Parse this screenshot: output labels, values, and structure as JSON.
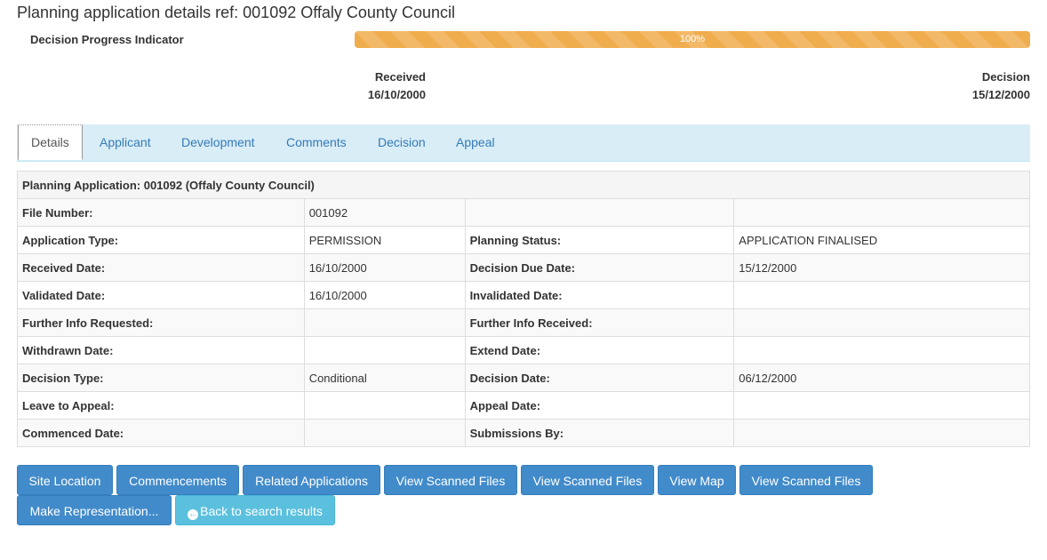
{
  "page": {
    "title": "Planning application details ref: 001092 Offaly County Council"
  },
  "progress": {
    "label": "Decision Progress Indicator",
    "percent": 100,
    "percent_text": "100%",
    "bar_color": "#f0ad4e",
    "received_label": "Received",
    "received_date": "16/10/2000",
    "decision_label": "Decision",
    "decision_date": "15/12/2000"
  },
  "tabs": [
    {
      "label": "Details",
      "active": true
    },
    {
      "label": "Applicant"
    },
    {
      "label": "Development"
    },
    {
      "label": "Comments"
    },
    {
      "label": "Decision"
    },
    {
      "label": "Appeal"
    }
  ],
  "details": {
    "heading": "Planning Application: 001092 (Offaly County Council)",
    "rows": [
      [
        "File Number:",
        "001092",
        "",
        ""
      ],
      [
        "Application Type:",
        "PERMISSION",
        "Planning Status:",
        "APPLICATION FINALISED"
      ],
      [
        "Received Date:",
        "16/10/2000",
        "Decision Due Date:",
        "15/12/2000"
      ],
      [
        "Validated Date:",
        "16/10/2000",
        "Invalidated Date:",
        ""
      ],
      [
        "Further Info Requested:",
        "",
        "Further Info Received:",
        ""
      ],
      [
        "Withdrawn Date:",
        "",
        "Extend Date:",
        ""
      ],
      [
        "Decision Type:",
        "Conditional",
        "Decision Date:",
        "06/12/2000"
      ],
      [
        "Leave to Appeal:",
        "",
        "Appeal Date:",
        ""
      ],
      [
        "Commenced Date:",
        "",
        "Submissions By:",
        ""
      ]
    ]
  },
  "buttons": {
    "site_location": "Site Location",
    "commencements": "Commencements",
    "related_applications": "Related Applications",
    "view_scanned_files_1": "View Scanned Files",
    "view_scanned_files_2": "View Scanned Files",
    "view_map": "View Map",
    "view_scanned_files_3": "View Scanned Files",
    "make_representation": "Make Representation...",
    "back_to_search": "Back to search results",
    "back_icon": "arrow-left-circle-icon",
    "primary_color": "#428bca",
    "info_color": "#5bc0de"
  }
}
